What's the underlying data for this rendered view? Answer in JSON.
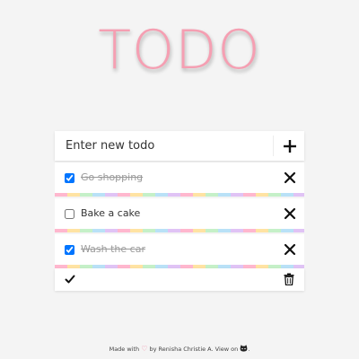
{
  "app": {
    "title": "TODO"
  },
  "new_todo": {
    "placeholder": "Enter new todo",
    "add_icon": "plus-icon"
  },
  "todos": [
    {
      "label": "Go shopping",
      "completed": true
    },
    {
      "label": "Bake a cake",
      "completed": false
    },
    {
      "label": "Wash the car",
      "completed": true
    }
  ],
  "toolbar": {
    "check_all_icon": "checkmark-icon",
    "clear_icon": "trash-icon"
  },
  "credit": {
    "prefix": "Made with",
    "middle": "by Renisha Christie A. View on",
    "suffix": ".",
    "heart_icon": "heart-icon",
    "github_icon": "github-icon"
  },
  "colors": {
    "title": "#f59fb2",
    "heart": "#f08aa3",
    "background": "#f4f4f4"
  }
}
